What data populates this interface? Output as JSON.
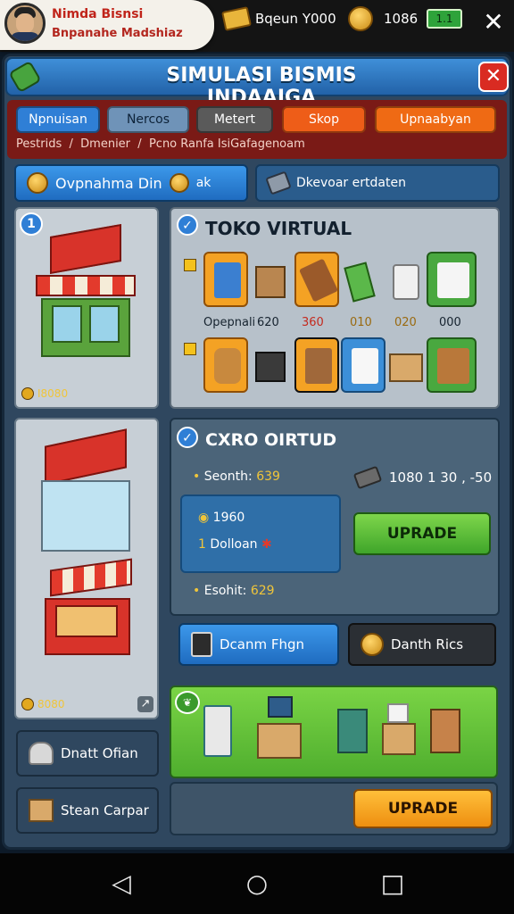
{
  "profile": {
    "name": "Nimda Bisnsi",
    "subtitle": "Bnpanahe Madshiaz"
  },
  "resources": [
    {
      "icon": "cash-stack-icon",
      "label": "Bqeun Y000"
    },
    {
      "icon": "gold-coin-icon",
      "label": "1086"
    },
    {
      "icon": "money-bill-icon",
      "label": "1.1"
    }
  ],
  "window": {
    "title": "SIMULASI BISMIS INDAAIGA"
  },
  "tabs": [
    "Npnuisan",
    "Nercos",
    "Metert",
    "Skop",
    "Upnaabyan"
  ],
  "breadcrumb": [
    "Pestrids",
    "Dmenier",
    "Pcno Ranfa IsiGafagenoam"
  ],
  "actions": {
    "left": "Ovpnahma Din",
    "left_badge": "ak",
    "right": "Dkevoar ertdaten"
  },
  "store1": {
    "number": "1",
    "price": "I8080"
  },
  "store2": {
    "price": "8080"
  },
  "toko": {
    "title": "TOKO VIRTUAL",
    "prices": [
      "Opepnali",
      "620",
      "360",
      "010",
      "020",
      "000"
    ]
  },
  "cxro": {
    "title": "CXRO OIRTUD",
    "seonth_label": "Seonth:",
    "seonth_value": "639",
    "tool_label": "1080 1 30 , -50",
    "box_line1": "1960",
    "box_line2_num": "1",
    "box_line2_text": "Dolloan",
    "esohit_label": "Esohit:",
    "esohit_value": "629",
    "upgrade1": "UPRADE"
  },
  "menu": {
    "btn1": "Dcanm Fhgn",
    "btn2": "Danth Rics",
    "side1": "Dnatt Ofian",
    "side2": "Stean Carpar"
  },
  "upgrade2": "UPRADE",
  "colors": {
    "accent_blue": "#2f7fd6",
    "accent_red": "#d92b22",
    "accent_green": "#49a83f",
    "accent_orange": "#f4a224"
  }
}
